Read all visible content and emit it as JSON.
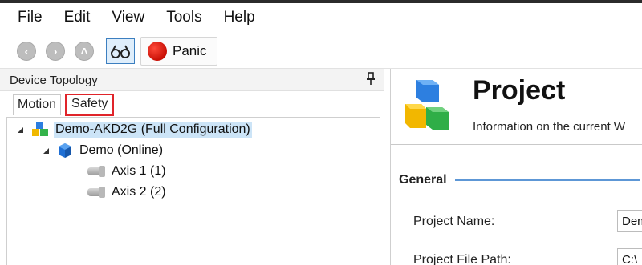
{
  "menu": [
    "File",
    "Edit",
    "View",
    "Tools",
    "Help"
  ],
  "toolbar": {
    "back_icon": "back-circle-icon",
    "forward_icon": "forward-circle-icon",
    "up_icon": "up-circle-icon",
    "view_icon": "glasses-icon",
    "panic_label": "Panic",
    "panic_color": "#d0140a"
  },
  "left_panel": {
    "title": "Device Topology",
    "tabs": [
      "Motion",
      "Safety"
    ],
    "highlight_color": "#e0242a",
    "tree": [
      {
        "label": "Demo-AKD2G (Full Configuration)",
        "icon": "config-blocks-icon",
        "selected": true
      },
      {
        "label": "Demo (Online)",
        "icon": "device-cube-icon"
      },
      {
        "label": "Axis 1 (1)",
        "icon": "axis-icon"
      },
      {
        "label": "Axis 2 (2)",
        "icon": "axis-icon"
      }
    ]
  },
  "right_panel": {
    "title": "Project",
    "subtitle": "Information on the current W",
    "section": "General",
    "fields": [
      {
        "label": "Project Name:",
        "value": "Dem"
      },
      {
        "label": "Project File Path:",
        "value": "C:\\"
      }
    ]
  }
}
